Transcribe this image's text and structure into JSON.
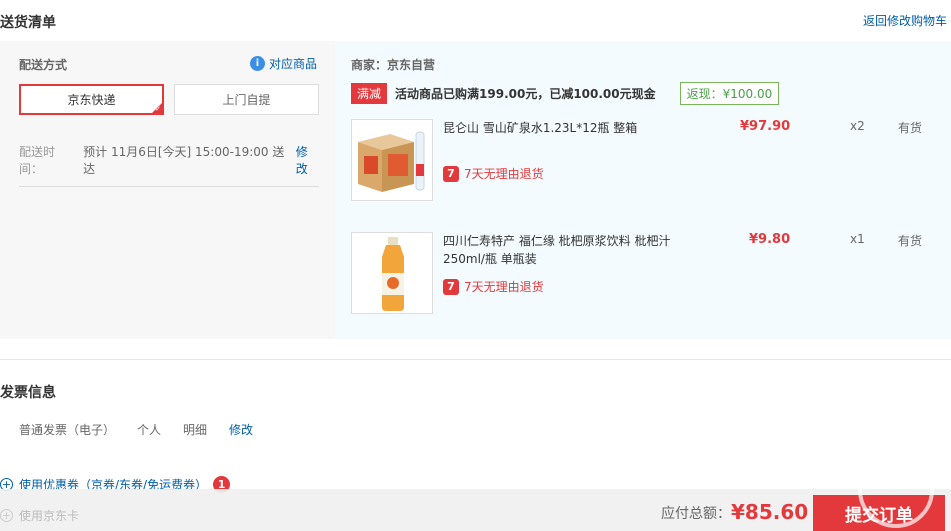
{
  "header": {
    "title": "送货清单",
    "back_link": "返回修改购物车"
  },
  "shipping": {
    "label": "配送方式",
    "goods_link": "对应商品",
    "options": [
      "京东快递",
      "上门自提"
    ],
    "time_label": "配送时间：",
    "time_value": "预计 11月6日[今天] 15:00-19:00 送达",
    "edit": "修改"
  },
  "store": {
    "merchant": "商家：京东自营",
    "promo_tag": "满减",
    "promo_text": "活动商品已购满199.00元，已减100.00元现金",
    "rebate": "返现：¥100.00"
  },
  "items": [
    {
      "name": "昆仑山 雪山矿泉水1.23L*12瓶 整箱",
      "return_text": "7天无理由退货",
      "price": "¥97.90",
      "qty": "x2",
      "stock": "有货"
    },
    {
      "name": "四川仁寿特产 福仁缘 枇杷原浆饮料 枇杷汁250ml/瓶 单瓶装",
      "return_text": "7天无理由退货",
      "price": "¥9.80",
      "qty": "x1",
      "stock": "有货"
    }
  ],
  "invoice": {
    "title": "发票信息",
    "type": "普通发票（电子）",
    "who": "个人",
    "content": "明细",
    "edit": "修改"
  },
  "coupon": {
    "label": "使用优惠券（京券/东券/免运费券）",
    "count": "1"
  },
  "card": {
    "label": "使用京东卡"
  },
  "footer": {
    "total_label": "应付总额：",
    "total_value": "¥85.60",
    "submit": "提交订单"
  },
  "colors": {
    "accent": "#e4393c",
    "link": "#005ea7",
    "rebate": "#4aa04a"
  },
  "icons": [
    "info-icon",
    "return-7day-icon",
    "plus-circle-icon",
    "selected-check-icon"
  ]
}
